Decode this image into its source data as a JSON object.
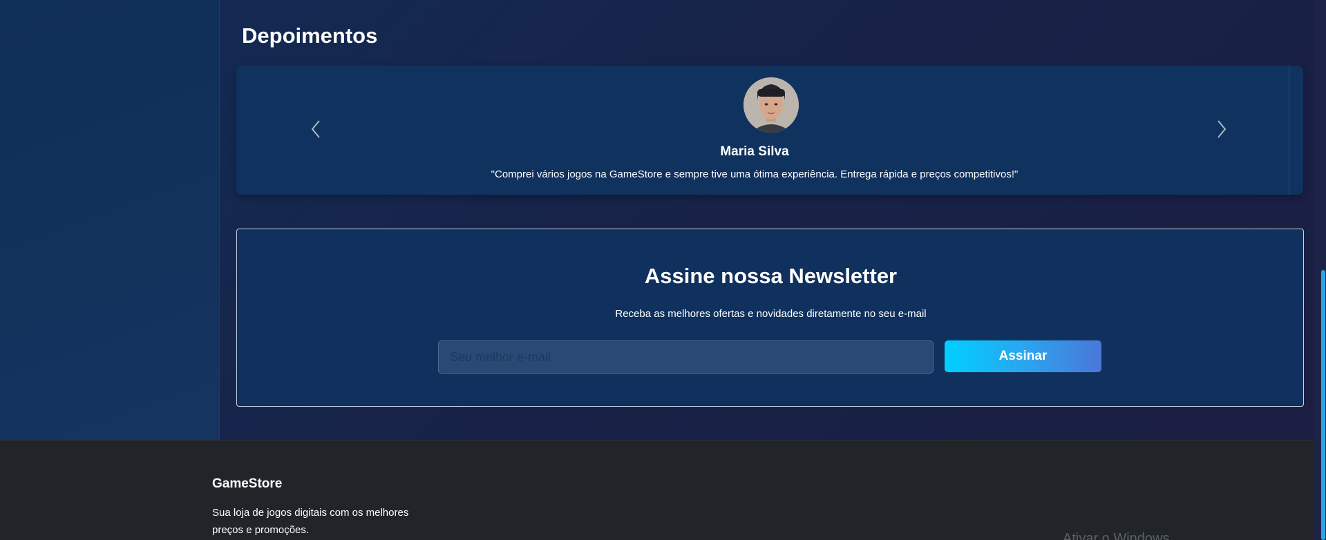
{
  "testimonials": {
    "title": "Depoimentos",
    "active": {
      "name": "Maria Silva",
      "quote": "\"Comprei vários jogos na GameStore e sempre tive uma ótima experiência. Entrega rápida e preços competitivos!\""
    },
    "prev_icon": "chevron-left-icon",
    "next_icon": "chevron-right-icon"
  },
  "newsletter": {
    "title": "Assine nossa Newsletter",
    "subtitle": "Receba as melhores ofertas e novidades diretamente no seu e-mail",
    "email_placeholder": "Seu melhor e-mail",
    "email_value": "",
    "submit_label": "Assinar"
  },
  "footer": {
    "brand": "GameStore",
    "description": "Sua loja de jogos digitais com os melhores preços e promoções.",
    "watermark": "Ativar o Windows"
  },
  "colors": {
    "accent_start": "#00cfff",
    "accent_end": "#4a76d8",
    "panel": "#10325f",
    "footer_bg": "#212529"
  }
}
